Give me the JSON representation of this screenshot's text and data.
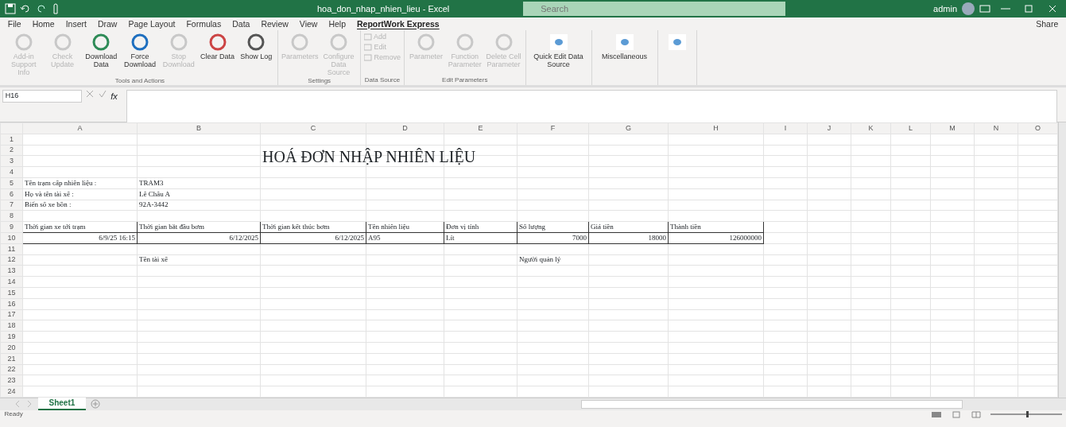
{
  "window": {
    "title": "hoa_don_nhap_nhien_lieu - Excel",
    "search_placeholder": "Search",
    "user": "admin"
  },
  "ribbon_tabs": [
    {
      "label": "File",
      "selected": false
    },
    {
      "label": "Home",
      "selected": false
    },
    {
      "label": "Insert",
      "selected": false
    },
    {
      "label": "Draw",
      "selected": false
    },
    {
      "label": "Page Layout",
      "selected": false
    },
    {
      "label": "Formulas",
      "selected": false
    },
    {
      "label": "Data",
      "selected": false
    },
    {
      "label": "Review",
      "selected": false
    },
    {
      "label": "View",
      "selected": false
    },
    {
      "label": "Help",
      "selected": false
    },
    {
      "label": "ReportWork Express",
      "selected": true
    }
  ],
  "share": "Share",
  "ribbon_groups": [
    {
      "label": "Tools and Actions",
      "buttons": [
        {
          "label": "Add-in Support Info",
          "disabled": true
        },
        {
          "label": "Check Update",
          "disabled": true
        },
        {
          "label": "Download Data",
          "disabled": false
        },
        {
          "label": "Force Download",
          "disabled": false
        },
        {
          "label": "Stop Download",
          "disabled": true
        },
        {
          "label": "Clear Data",
          "disabled": false
        },
        {
          "label": "Show Log",
          "disabled": false
        }
      ]
    },
    {
      "label": "Settings",
      "buttons": [
        {
          "label": "Parameters",
          "disabled": true
        },
        {
          "label": "Configure Data Source",
          "disabled": true
        }
      ]
    },
    {
      "label": "Data Source",
      "small": true,
      "buttons": [
        {
          "label": "Add",
          "disabled": true
        },
        {
          "label": "Edit",
          "disabled": true
        },
        {
          "label": "Remove",
          "disabled": true
        }
      ]
    },
    {
      "label": "Edit Parameters",
      "buttons": [
        {
          "label": "Parameter",
          "disabled": true
        },
        {
          "label": "Function Parameter",
          "disabled": true
        },
        {
          "label": "Delete Cell Parameter",
          "disabled": true
        }
      ]
    },
    {
      "buttons": [
        {
          "label": "Quick Edit Data Source",
          "disabled": false
        }
      ]
    },
    {
      "buttons": [
        {
          "label": "Miscellaneous",
          "disabled": false
        }
      ]
    },
    {
      "buttons": [
        {
          "disabled": false
        }
      ]
    }
  ],
  "formula_bar": {
    "name_box": "H16",
    "function_label": "fx"
  },
  "sheet": {
    "columns": [
      "A",
      "B",
      "C",
      "D",
      "E",
      "F",
      "G",
      "H",
      "I",
      "J",
      "K",
      "L",
      "M",
      "N",
      "O"
    ],
    "rows": [
      {
        "header": "1"
      },
      {
        "header": "2"
      },
      {
        "header": "3",
        "cells": [
          null,
          null,
          {
            "text": "HOÁ ĐƠN NHẬP NHIÊN LIỆU",
            "kind": "title"
          }
        ]
      },
      {
        "header": "4"
      },
      {
        "header": "5",
        "cells": [
          {
            "text": "Tên trạm cấp nhiên liệu :"
          },
          {
            "text": "TRAM3"
          }
        ]
      },
      {
        "header": "6",
        "cells": [
          {
            "text": "Họ và tên tài xế :"
          },
          {
            "text": "Lê Châu A"
          }
        ]
      },
      {
        "header": "7",
        "cells": [
          {
            "text": "Biển số xe bồn :"
          },
          {
            "text": "92A-3442"
          }
        ]
      },
      {
        "header": "8"
      },
      {
        "header": "9",
        "boxed": true,
        "cells": [
          {
            "text": "Thời gian xe tới trạm"
          },
          {
            "text": "Thời gian bắt đầu bơm"
          },
          {
            "text": "Thời gian kết thúc bơm"
          },
          {
            "text": "Tên nhiên liệu"
          },
          {
            "text": "Đơn vị tính"
          },
          {
            "text": "Số lượng"
          },
          {
            "text": "Giá tiền"
          },
          {
            "text": "Thành tiền"
          }
        ]
      },
      {
        "header": "10",
        "boxed": true,
        "cells": [
          {
            "text": "6/9/25 16:15",
            "kind": "number"
          },
          {
            "text": "6/12/2025",
            "kind": "number"
          },
          {
            "text": "6/12/2025",
            "kind": "number"
          },
          {
            "text": "A95"
          },
          {
            "text": "Lít"
          },
          {
            "text": "7000",
            "kind": "number"
          },
          {
            "text": "18000",
            "kind": "number"
          },
          {
            "text": "126000000",
            "kind": "number"
          }
        ]
      },
      {
        "header": "11"
      },
      {
        "header": "12",
        "cells": [
          null,
          {
            "text": "Tên tài xế"
          },
          null,
          null,
          null,
          {
            "text": "Người quản lý"
          }
        ]
      },
      {
        "header": "13"
      },
      {
        "header": "14"
      },
      {
        "header": "15"
      },
      {
        "header": "16"
      },
      {
        "header": "17"
      },
      {
        "header": "18"
      },
      {
        "header": "19"
      },
      {
        "header": "20"
      },
      {
        "header": "21"
      },
      {
        "header": "22"
      },
      {
        "header": "23"
      },
      {
        "header": "24"
      }
    ]
  },
  "sheet_tabs": [
    {
      "label": "Sheet1",
      "selected": true
    }
  ],
  "status_bar": {
    "status": "Ready",
    "zoom": {
      "level": 0.5
    }
  }
}
